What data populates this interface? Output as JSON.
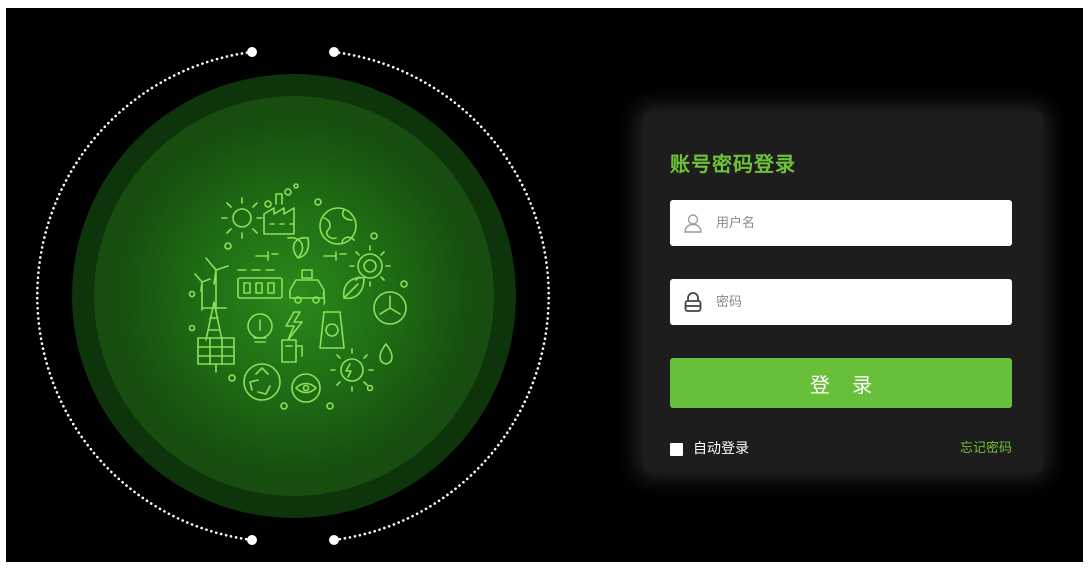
{
  "colors": {
    "background": "#000000",
    "panel": "#1d1d1d",
    "accent": "#6ec238",
    "button": "#67bf3a",
    "circle_outer": "#0e3a0a",
    "circle_inner": "#1f6a14",
    "line_art": "#8ee05a"
  },
  "illustration": {
    "icon": "energy-environment-line-art-icon"
  },
  "login": {
    "title": "账号密码登录",
    "username": {
      "icon": "user-icon",
      "placeholder": "用户名",
      "value": ""
    },
    "password": {
      "icon": "lock-icon",
      "placeholder": "密码",
      "value": ""
    },
    "submit_label": "登 录",
    "remember_label": "自动登录",
    "remember_checked": false,
    "forgot_label": "忘记密码"
  }
}
